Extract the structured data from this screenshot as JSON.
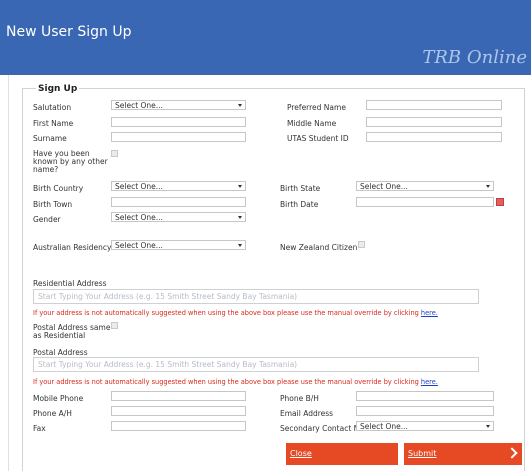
{
  "header": {
    "title": "New User Sign Up",
    "brand": "TRB Online"
  },
  "section": {
    "legend": "Sign Up"
  },
  "select_placeholder": "Select One...",
  "labels": {
    "salutation": "Salutation",
    "first_name": "First Name",
    "surname": "Surname",
    "known_other_name": "Have you been known by any other name?",
    "preferred_name": "Preferred Name",
    "middle_name": "Middle Name",
    "utas_id": "UTAS Student ID",
    "birth_country": "Birth Country",
    "birth_town": "Birth Town",
    "gender": "Gender",
    "birth_state": "Birth State",
    "birth_date": "Birth Date",
    "australian_residency": "Australian Residency",
    "nz_citizen": "New Zealand Citizen",
    "residential_address": "Residential Address",
    "postal_same": "Postal Address same as Residential",
    "postal_address": "Postal Address",
    "mobile_phone": "Mobile Phone",
    "phone_ah": "Phone A/H",
    "fax": "Fax",
    "phone_bh": "Phone B/H",
    "email": "Email Address",
    "secondary_contact": "Secondary Contact Method"
  },
  "address": {
    "placeholder": "Start Typing Your Address (e.g. 15 Smith Street Sandy Bay Tasmania)",
    "warning": "If your address is not automatically suggested when using the above box please use the manual override by clicking",
    "link": "here."
  },
  "buttons": {
    "close": "Close",
    "submit": "Submit"
  },
  "colors": {
    "header": "#3a67b3",
    "button": "#e64a25",
    "warning": "#d8281c",
    "link": "#1f3ec6"
  }
}
